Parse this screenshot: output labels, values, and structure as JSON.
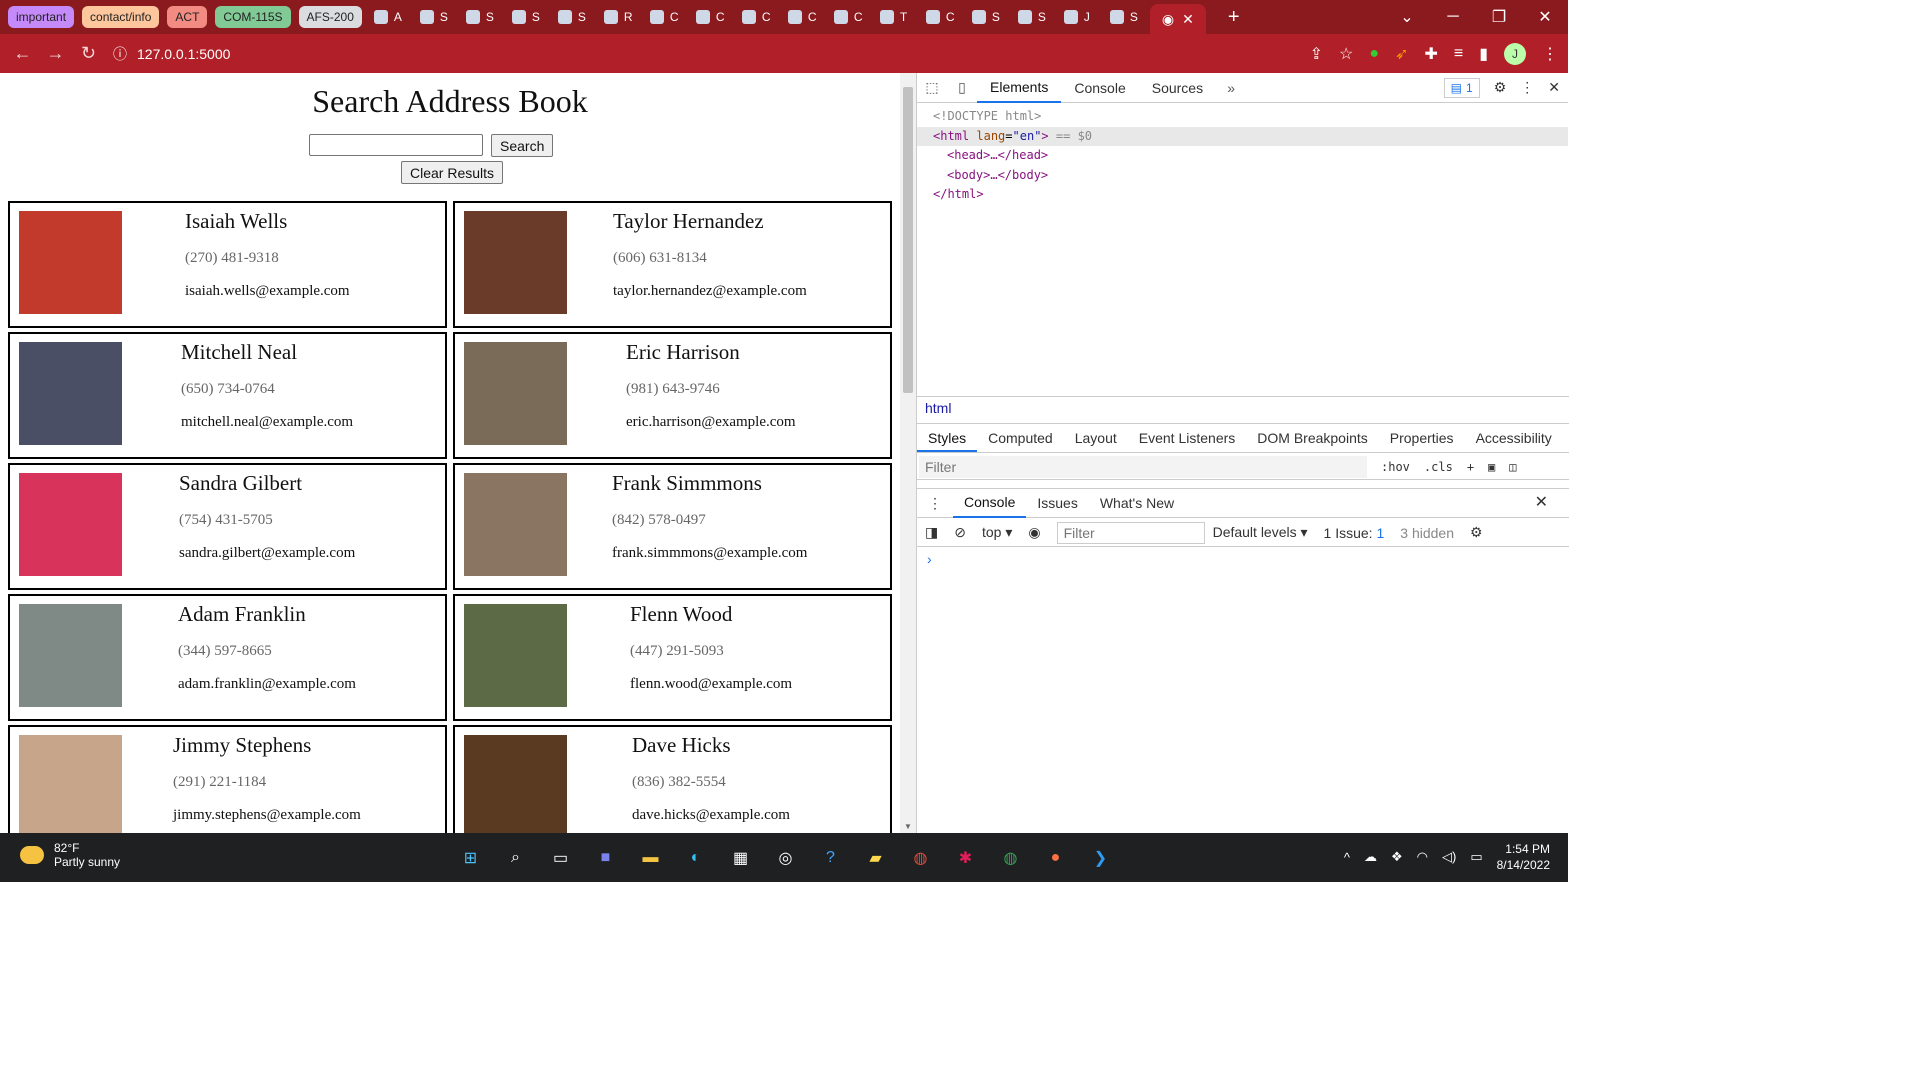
{
  "browser": {
    "tab_groups": [
      {
        "label": "important",
        "color": "#c58af9"
      },
      {
        "label": "contact/info",
        "color": "#fdc69c"
      },
      {
        "label": "ACT",
        "color": "#f28b82"
      },
      {
        "label": "COM-115S",
        "color": "#81c995"
      },
      {
        "label": "AFS-200",
        "color": "#dadce0"
      }
    ],
    "tabs": [
      "A",
      "S",
      "S",
      "S",
      "S",
      "R",
      "C",
      "C",
      "C",
      "C",
      "C",
      "T",
      "C",
      "S",
      "S",
      "J",
      "S"
    ],
    "url": "127.0.0.1:5000",
    "profile_initial": "J"
  },
  "page": {
    "title": "Search Address Book",
    "search_button": "Search",
    "clear_button": "Clear Results",
    "contacts": [
      {
        "name": "Isaiah Wells",
        "phone": "(270) 481-9318",
        "email": "isaiah.wells@example.com",
        "photo_color": "#c23a2c"
      },
      {
        "name": "Taylor Hernandez",
        "phone": "(606) 631-8134",
        "email": "taylor.hernandez@example.com",
        "photo_color": "#6b3b2a"
      },
      {
        "name": "Mitchell Neal",
        "phone": "(650) 734-0764",
        "email": "mitchell.neal@example.com",
        "photo_color": "#4a4f66"
      },
      {
        "name": "Eric Harrison",
        "phone": "(981) 643-9746",
        "email": "eric.harrison@example.com",
        "photo_color": "#7a6b58"
      },
      {
        "name": "Sandra Gilbert",
        "phone": "(754) 431-5705",
        "email": "sandra.gilbert@example.com",
        "photo_color": "#d8335a"
      },
      {
        "name": "Frank Simmmons",
        "phone": "(842) 578-0497",
        "email": "frank.simmmons@example.com",
        "photo_color": "#8a7462"
      },
      {
        "name": "Adam Franklin",
        "phone": "(344) 597-8665",
        "email": "adam.franklin@example.com",
        "photo_color": "#7f8a86"
      },
      {
        "name": "Flenn Wood",
        "phone": "(447) 291-5093",
        "email": "flenn.wood@example.com",
        "photo_color": "#5c6b45"
      },
      {
        "name": "Jimmy Stephens",
        "phone": "(291) 221-1184",
        "email": "jimmy.stephens@example.com",
        "photo_color": "#c7a58a"
      },
      {
        "name": "Dave Hicks",
        "phone": "(836) 382-5554",
        "email": "dave.hicks@example.com",
        "photo_color": "#5a3b22"
      }
    ]
  },
  "devtools": {
    "tabs": [
      "Elements",
      "Console",
      "Sources"
    ],
    "issues_count": "1",
    "dom_lines": {
      "doctype": "<!DOCTYPE html>",
      "html_open_tag": "html",
      "html_lang_attr": "lang",
      "html_lang_val": "\"en\"",
      "html_sel_marker": "== $0",
      "head": "<head>…</head>",
      "body": "<body>…</body>",
      "html_close": "</html>"
    },
    "breadcrumb": "html",
    "sub_tabs": [
      "Styles",
      "Computed",
      "Layout",
      "Event Listeners",
      "DOM Breakpoints",
      "Properties",
      "Accessibility"
    ],
    "styles_filter_placeholder": "Filter",
    "hov": ":hov",
    "cls": ".cls",
    "drawer_tabs": [
      "Console",
      "Issues",
      "What's New"
    ],
    "console_context": "top",
    "console_filter_placeholder": "Filter",
    "levels": "Default levels",
    "issue_label": "1 Issue:",
    "issue_count": "1",
    "hidden": "3 hidden"
  },
  "taskbar": {
    "temp": "82°F",
    "weather": "Partly sunny",
    "time": "1:54 PM",
    "date": "8/14/2022"
  }
}
